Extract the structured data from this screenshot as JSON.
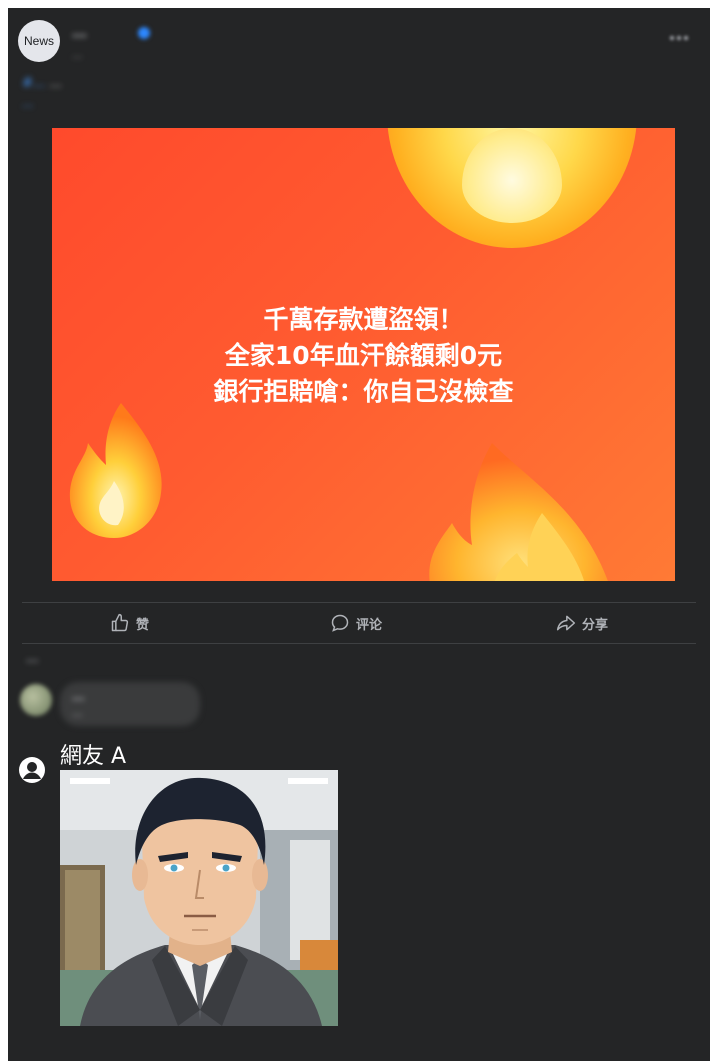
{
  "post": {
    "avatar_text": "News",
    "page_name": "...",
    "meta": "...",
    "text_line1_link": "#...",
    "text_line1": "...",
    "text_line2": "..."
  },
  "hero": {
    "line1": "千萬存款遭盜領！",
    "line2": "全家10年血汗餘額剩0元",
    "line3": "銀行拒賠嗆：你自己沒檢查"
  },
  "actions": {
    "like_label": "赞",
    "comment_label": "评论",
    "share_label": "分享"
  },
  "comments": {
    "sort_label": "...",
    "first": {
      "name": "...",
      "text": "..."
    },
    "reply": {
      "name": "網友 A"
    }
  },
  "colors": {
    "background": "#242526",
    "hero_orange": "#ff5b30",
    "muted_text": "#b0b3b8"
  }
}
